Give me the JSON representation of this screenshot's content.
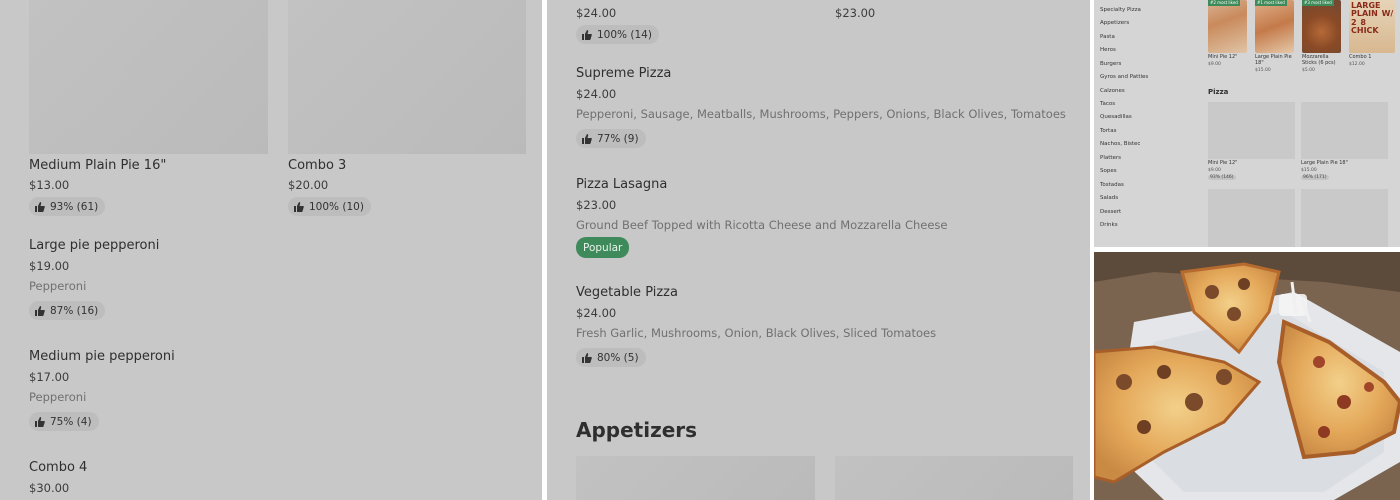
{
  "panel1": {
    "items": [
      {
        "name": "Medium Plain Pie 16\"",
        "price": "$13.00",
        "rating": "93% (61)"
      },
      {
        "name": "Combo 3",
        "price": "$20.00",
        "rating": "100% (10)"
      },
      {
        "name": "Large pie pepperoni",
        "price": "$19.00",
        "description": "Pepperoni",
        "rating": "87% (16)"
      },
      {
        "name": "Medium pie pepperoni",
        "price": "$17.00",
        "description": "Pepperoni",
        "rating": "75% (4)"
      },
      {
        "name": "Combo 4",
        "price": "$30.00"
      }
    ]
  },
  "panel2": {
    "top_left_price": "$24.00",
    "top_right_price": "$23.00",
    "top_rating": "100% (14)",
    "items": [
      {
        "name": "Supreme Pizza",
        "price": "$24.00",
        "description": "Pepperoni, Sausage, Meatballs, Mushrooms, Peppers, Onions, Black Olives, Tomatoes",
        "rating": "77% (9)"
      },
      {
        "name": "Pizza Lasagna",
        "price": "$23.00",
        "description": "Ground Beef Topped with Ricotta Cheese and Mozzarella Cheese",
        "badge": "Popular"
      },
      {
        "name": "Vegetable Pizza",
        "price": "$24.00",
        "description": "Fresh Garlic, Mushrooms, Onion, Black Olives, Sliced Tomatoes",
        "rating": "80% (5)"
      }
    ],
    "section_heading": "Appetizers"
  },
  "panel3": {
    "sidebar": [
      "Specialty Pizza",
      "Appetizers",
      "Pasta",
      "Heros",
      "Burgers",
      "Gyros and Patties",
      "Calzones",
      "Tacos",
      "Quesadillas",
      "Tortas",
      "Nachos, Bistec",
      "Platters",
      "Sopes",
      "Tostadas",
      "Salads",
      "Dessert",
      "Drinks"
    ],
    "featured": [
      {
        "name": "Mini Pie 12\"",
        "price": "$9.00",
        "tag": "#2 most liked"
      },
      {
        "name": "Large Plain Pie 18\"",
        "price": "$15.00",
        "tag": "#1 most liked"
      },
      {
        "name": "Mozzarella Sticks (6 pcs)",
        "price": "$5.00",
        "tag": "#3 most liked"
      },
      {
        "name": "Combo 1",
        "price": "$12.00",
        "banner": "LARGE PLAIN W/ 2 8 CHICK"
      }
    ],
    "section": "Pizza",
    "pizza_items": [
      {
        "name": "Mini Pie 12\"",
        "price": "$9.00",
        "rating": "93% (146)"
      },
      {
        "name": "Large Plain Pie 18\"",
        "price": "$15.00",
        "rating": "96% (171)"
      }
    ]
  },
  "colors": {
    "overlay_gray": "#c8c8c8",
    "popular_green": "#3e8a5a"
  },
  "icons": {
    "rating": "thumbs-up-icon"
  }
}
